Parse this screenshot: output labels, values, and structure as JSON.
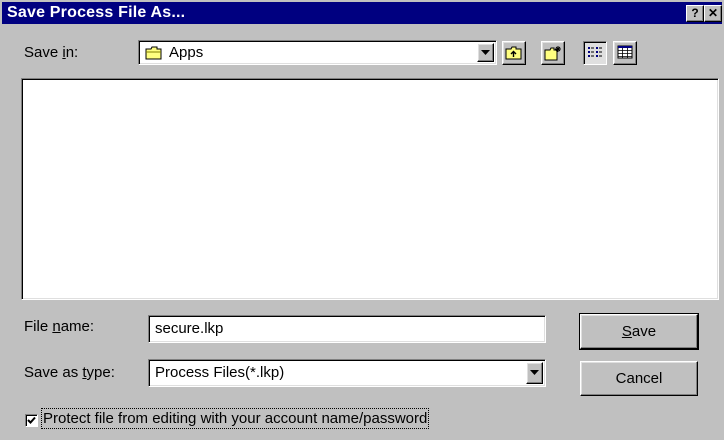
{
  "window": {
    "title": "Save Process File As...",
    "help_glyph": "?",
    "close_glyph": "✕"
  },
  "save_in": {
    "label_pre": "Save ",
    "label_acc": "i",
    "label_post": "n:",
    "value": "Apps"
  },
  "toolbar": {
    "icons": [
      "up-one-level-icon",
      "create-new-folder-icon",
      "list-view-icon",
      "details-view-icon"
    ]
  },
  "file_name": {
    "label_pre": "File ",
    "label_acc": "n",
    "label_post": "ame:",
    "value": "secure.lkp"
  },
  "save_as_type": {
    "label_pre": "Save as ",
    "label_acc": "t",
    "label_post": "ype:",
    "value": "Process Files(*.lkp)"
  },
  "buttons": {
    "save_acc": "S",
    "save_post": "ave",
    "cancel": "Cancel"
  },
  "protect": {
    "checked": true,
    "label": "Protect file from editing with your account name/password"
  }
}
